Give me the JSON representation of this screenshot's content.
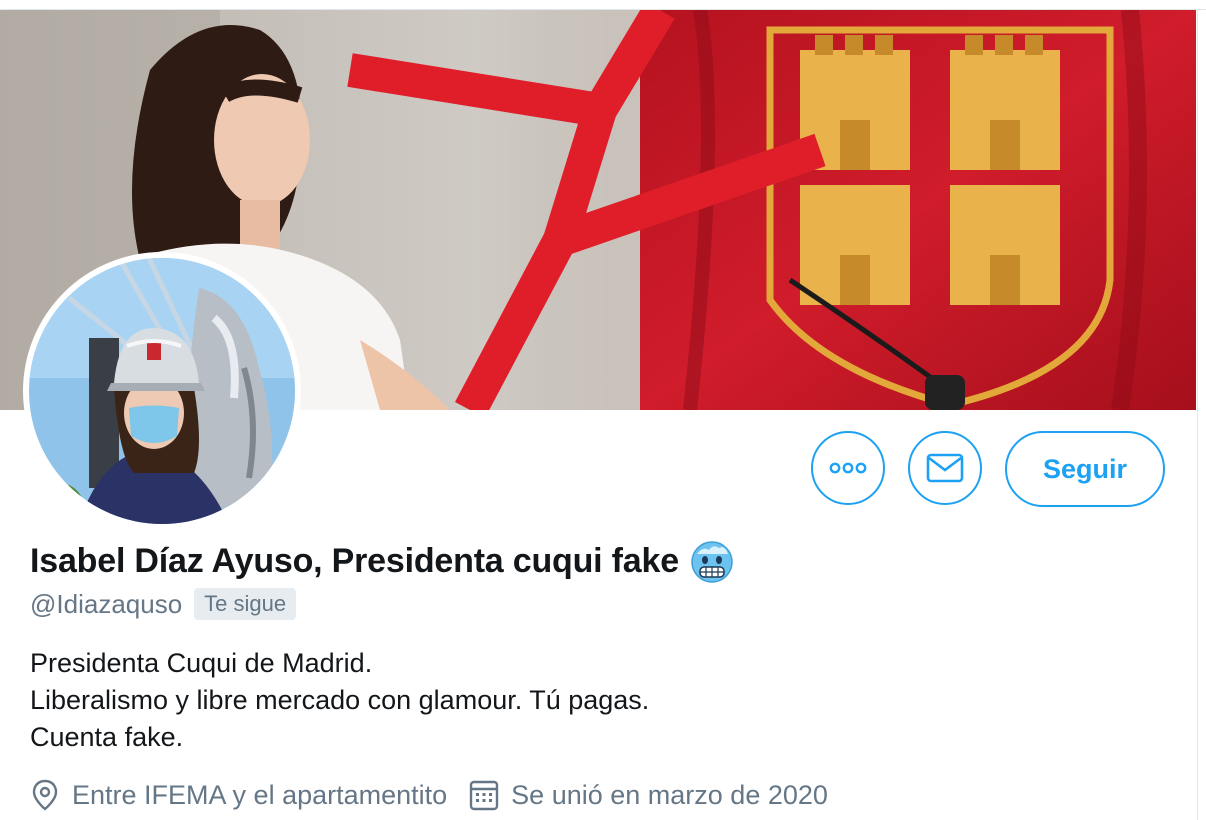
{
  "profile": {
    "display_name": "Isabel Díaz Ayuso, Presidenta cuqui fake",
    "name_emoji": "freezing-face-emoji",
    "handle": "@Idiazaquso",
    "follows_you_label": "Te sigue",
    "bio_lines": [
      "Presidenta Cuqui de Madrid.",
      "Liberalismo y libre mercado con glamour. Tú pagas.",
      "Cuenta fake."
    ],
    "location": "Entre IFEMA y el apartamentito",
    "joined": "Se unió en marzo de 2020"
  },
  "actions": {
    "more_icon": "more-dots-icon",
    "message_icon": "envelope-icon",
    "follow_label": "Seguir"
  },
  "colors": {
    "accent": "#1da1f2",
    "secondary_text": "#657786",
    "primary_text": "#14171a",
    "badge_bg": "#e6ecf0",
    "banner_red": "#c8192a"
  }
}
